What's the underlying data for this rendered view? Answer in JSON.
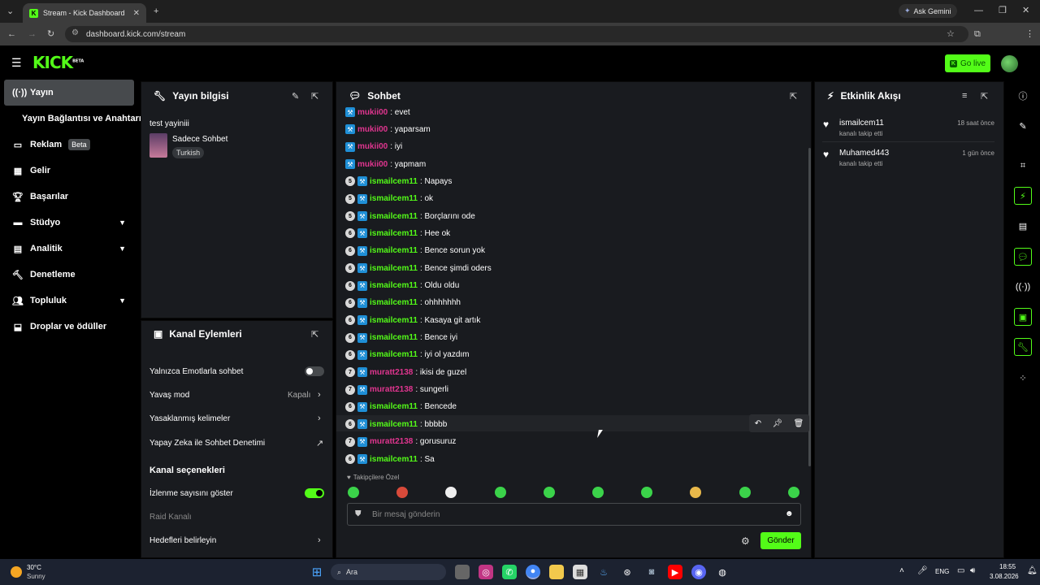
{
  "browser": {
    "tab_title": "Stream - Kick Dashboard",
    "url": "dashboard.kick.com/stream",
    "ask_gemini": "Ask Gemini",
    "profile_letter": "K"
  },
  "header": {
    "logo": "KICK",
    "logo_sup": "BETA",
    "go_live": "Go live"
  },
  "nav": {
    "items": [
      {
        "label": "Yayın",
        "icon": "broadcast-icon"
      },
      {
        "label": "Yayın Bağlantısı ve Anahtarı"
      },
      {
        "label": "Reklam",
        "badge": "Beta",
        "icon": "ad-icon"
      },
      {
        "label": "Gelir",
        "icon": "chart-icon"
      },
      {
        "label": "Başarılar",
        "icon": "trophy-icon"
      },
      {
        "label": "Stüdyo",
        "icon": "studio-icon"
      },
      {
        "label": "Analitik",
        "icon": "analytics-icon"
      },
      {
        "label": "Denetleme",
        "icon": "moderation-icon"
      },
      {
        "label": "Topluluk",
        "icon": "community-icon"
      },
      {
        "label": "Droplar ve ödüller",
        "icon": "drops-icon"
      }
    ]
  },
  "stream_info": {
    "title": "Yayın bilgisi",
    "stream_title": "test yayiniii",
    "category": "Sadece Sohbet",
    "tag": "Turkish"
  },
  "channel_actions": {
    "title": "Kanal Eylemleri",
    "rows": [
      {
        "label": "Yalnızca Emotlarla sohbet"
      },
      {
        "label": "Yavaş mod",
        "value": "Kapalı"
      },
      {
        "label": "Yasaklanmış kelimeler"
      },
      {
        "label": "Yapay Zeka ile Sohbet Denetimi"
      }
    ],
    "section": "Kanal seçenekleri",
    "options": [
      {
        "label": "İzlenme sayısını göster"
      },
      {
        "label": "Raid Kanalı"
      },
      {
        "label": "Hedefleri belirleyin"
      }
    ]
  },
  "chat": {
    "title": "Sohbet",
    "messages": [
      {
        "badge": "",
        "user": "mukii00",
        "text": ": evet",
        "color": "#e0358f"
      },
      {
        "badge": "",
        "user": "mukii00",
        "text": ": yaparsam",
        "color": "#e0358f"
      },
      {
        "badge": "",
        "user": "mukii00",
        "text": ": iyi",
        "color": "#e0358f"
      },
      {
        "badge": "",
        "user": "mukii00",
        "text": ": yapmam",
        "color": "#e0358f"
      },
      {
        "badge": "5",
        "user": "ismailcem11",
        "text": ": Napays",
        "color": "#53fc18"
      },
      {
        "badge": "5",
        "user": "ismailcem11",
        "text": ": ok",
        "color": "#53fc18"
      },
      {
        "badge": "5",
        "user": "ismailcem11",
        "text": ": Borçlarını ode",
        "color": "#53fc18"
      },
      {
        "badge": "6",
        "user": "ismailcem11",
        "text": ": Hee ok",
        "color": "#53fc18"
      },
      {
        "badge": "6",
        "user": "ismailcem11",
        "text": ": Bence sorun yok",
        "color": "#53fc18"
      },
      {
        "badge": "6",
        "user": "ismailcem11",
        "text": ": Bence şimdi oders",
        "color": "#53fc18"
      },
      {
        "badge": "6",
        "user": "ismailcem11",
        "text": ": Oldu oldu",
        "color": "#53fc18"
      },
      {
        "badge": "6",
        "user": "ismailcem11",
        "text": ": ohhhhhhh",
        "color": "#53fc18"
      },
      {
        "badge": "6",
        "user": "ismailcem11",
        "text": ": Kasaya git artık",
        "color": "#53fc18"
      },
      {
        "badge": "6",
        "user": "ismailcem11",
        "text": ": Bence iyi",
        "color": "#53fc18"
      },
      {
        "badge": "6",
        "user": "ismailcem11",
        "text": ": iyi ol yazdım",
        "color": "#53fc18"
      },
      {
        "badge": "7",
        "user": "muratt2138",
        "text": ": ikisi de guzel",
        "color": "#e0358f"
      },
      {
        "badge": "7",
        "user": "muratt2138",
        "text": ": sungerli",
        "color": "#e0358f"
      },
      {
        "badge": "6",
        "user": "ismailcem11",
        "text": ": Bencede",
        "color": "#53fc18"
      },
      {
        "badge": "6",
        "user": "ismailcem11",
        "text": ": bbbbb",
        "color": "#53fc18"
      },
      {
        "badge": "7",
        "user": "muratt2138",
        "text": ": gorusuruz",
        "color": "#e0358f"
      },
      {
        "badge": "6",
        "user": "ismailcem11",
        "text": ": Sa",
        "color": "#53fc18"
      }
    ],
    "followers_label": "Takipçilere Özel",
    "placeholder": "Bir mesaj gönderin",
    "send": "Gönder"
  },
  "activity": {
    "title": "Etkinlik Akışı",
    "items": [
      {
        "user": "ismailcem11",
        "action": "kanalı takip etti",
        "time": "18 saat önce"
      },
      {
        "user": "Muhamed443",
        "action": "kanalı takip etti",
        "time": "1 gün önce"
      }
    ]
  },
  "taskbar": {
    "temp": "30°C",
    "weather": "Sunny",
    "search": "Ara",
    "lang": "ENG",
    "time": "18:55",
    "date": "3.08.2026"
  },
  "colors": {
    "accent": "#53fc18",
    "panel": "#191b1f",
    "pink_user": "#e0358f"
  }
}
